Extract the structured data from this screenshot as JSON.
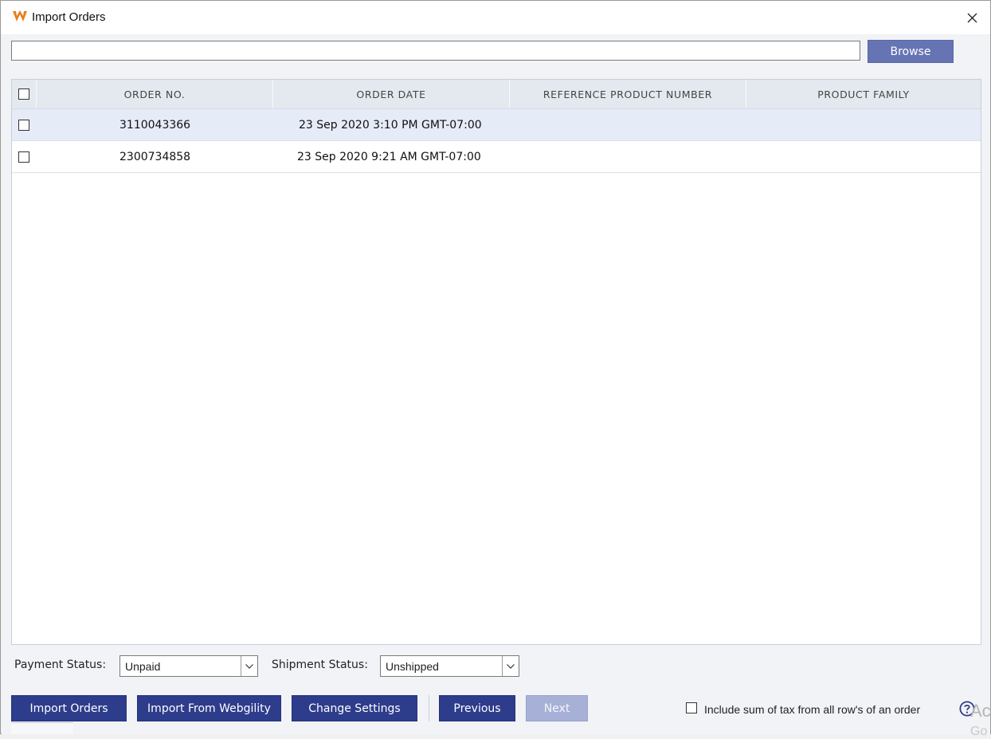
{
  "window": {
    "title": "Import Orders"
  },
  "file": {
    "path_value": "",
    "browse_label": "Browse"
  },
  "grid": {
    "columns": [
      "ORDER NO.",
      "ORDER DATE",
      "REFERENCE PRODUCT NUMBER",
      "PRODUCT FAMILY"
    ],
    "rows": [
      {
        "order_no": "3110043366",
        "order_date": "23 Sep 2020 3:10 PM GMT-07:00",
        "reference_product_number": "",
        "product_family": "",
        "selected": true
      },
      {
        "order_no": "2300734858",
        "order_date": "23 Sep 2020 9:21 AM GMT-07:00",
        "reference_product_number": "",
        "product_family": "",
        "selected": false
      }
    ]
  },
  "filters": {
    "payment_label": "Payment Status:",
    "payment_value": "Unpaid",
    "shipment_label": "Shipment Status:",
    "shipment_value": "Unshipped"
  },
  "actions": {
    "import_orders": "Import Orders",
    "import_from_webgility": "Import From Webgility",
    "change_settings": "Change Settings",
    "previous": "Previous",
    "next": "Next"
  },
  "tax_option": {
    "label": "Include sum of tax from all row's of an order",
    "checked": false
  },
  "watermark": {
    "line1": "Ac",
    "line2": "Go"
  },
  "colors": {
    "accent": "#2e3c8c",
    "browse": "#6674b4",
    "disabled": "#a7b0d6",
    "logo": "#e8801f"
  },
  "icons": {
    "app": "webgility-logo-icon",
    "close": "close-icon",
    "dropdown": "chevron-down-icon",
    "help": "help-icon"
  }
}
